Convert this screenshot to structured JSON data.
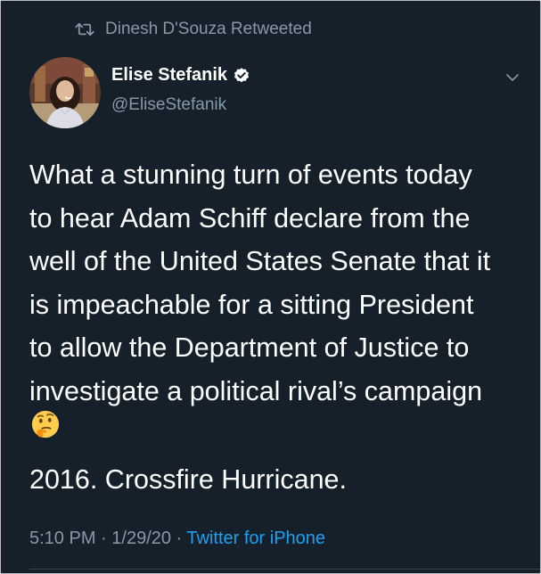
{
  "retweet": {
    "icon": "retweet-icon",
    "text": "Dinesh D'Souza Retweeted"
  },
  "author": {
    "avatar_icon": "user-avatar",
    "name": "Elise Stefanik",
    "verified_icon": "verified-badge-icon",
    "handle": "@EliseStefanik"
  },
  "menu_icon": "chevron-down-icon",
  "tweet": {
    "lines": [
      "What a stunning turn of events today",
      "to hear Adam Schiff declare from the",
      "well of the United States Senate that it",
      "is impeachable for a sitting President",
      "to allow the Department of Justice to",
      "investigate a political rival’s campaign"
    ],
    "emoji": "thinking-face-emoji",
    "second_paragraph": "2016. Crossfire Hurricane."
  },
  "meta": {
    "time": "5:10 PM",
    "date": "1/29/20",
    "separator": " · ",
    "source": "Twitter for iPhone"
  },
  "colors": {
    "background": "#15202b",
    "text": "#ffffff",
    "secondary": "#8899a6",
    "link": "#1da1f2"
  }
}
